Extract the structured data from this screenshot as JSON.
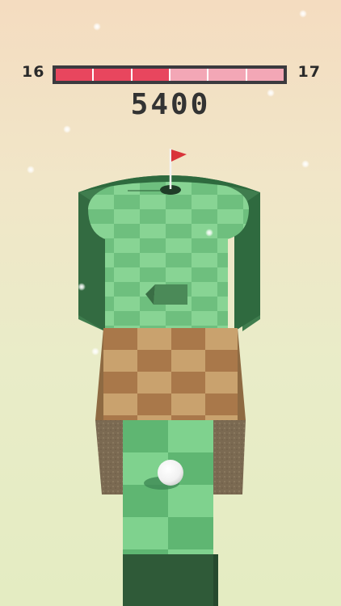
{
  "hud": {
    "current_level": "16",
    "next_level": "17",
    "score": "5400",
    "progress_segments_total": 6,
    "progress_segments_filled": 3,
    "progress_filled_color": "#e8465e",
    "progress_empty_color": "#f3a7b6"
  },
  "scene": {
    "course": "mini-golf-level",
    "ball_color": "#ffffff",
    "flag_color": "#d9343a",
    "grass_light": "#8fd99c",
    "grass_dark": "#6bbf7c",
    "sand_light": "#c79f6c",
    "sand_dark": "#a9784a",
    "wall_color": "#3d7a4c"
  }
}
